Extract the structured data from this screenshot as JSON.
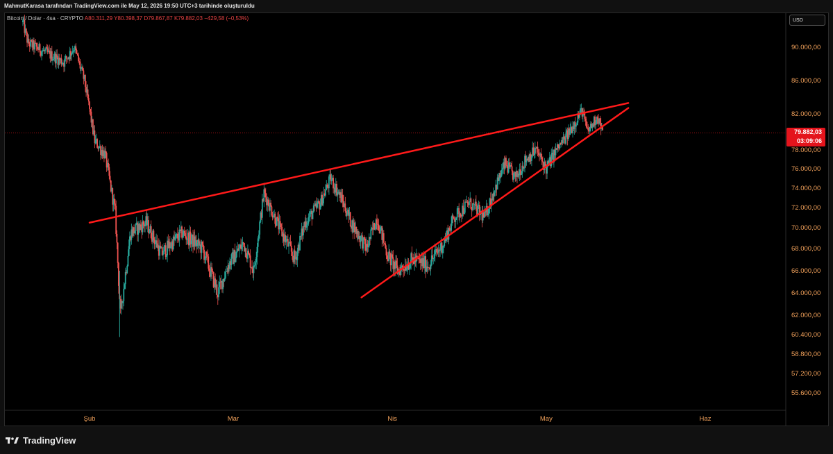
{
  "header": {
    "title": "MahmutKarasa tarafından TradingView.com ile May 12, 2026 19:50 UTC+3 tarihinde oluşturuldu"
  },
  "legend": {
    "symbol": "Bitcoin / Dolar · 4sa · CRYPTO",
    "open_label": "A",
    "open": "80.311,29",
    "high_label": "Y",
    "high": "80.398,37",
    "low_label": "D",
    "low": "79.867,87",
    "close_label": "K",
    "close": "79.882,03",
    "change": "−429,58 (−0,53%)"
  },
  "currency": "USD",
  "price_tag": {
    "price": "79.882,03",
    "countdown": "03:09:06",
    "color": "#e4141c"
  },
  "branding": {
    "name": "TradingView"
  },
  "colors": {
    "up": "#26a69a",
    "down": "#ef5350",
    "trendline": "#ff1a1a",
    "axis_text": "#f0a05a"
  },
  "chart_data": {
    "type": "candlestick",
    "y_ticks": [
      90000,
      86000,
      82000,
      78000,
      76000,
      74000,
      72000,
      70000,
      68000,
      66000,
      64000,
      62000,
      60400,
      58800,
      57200,
      55600
    ],
    "y_tick_labels": [
      "90.000,00",
      "86.000,00",
      "82.000,00",
      "78.000,00",
      "76.000,00",
      "74.000,00",
      "72.000,00",
      "70.000,00",
      "68.000,00",
      "66.000,00",
      "64.000,00",
      "62.000,00",
      "60.400,00",
      "58.800,00",
      "57.200,00",
      "55.600,00"
    ],
    "x_ticks": [
      "2026-02-01",
      "2026-03-01",
      "2026-04-01",
      "2026-05-01",
      "2026-06-01"
    ],
    "x_tick_labels": [
      "Şub",
      "Mar",
      "Nis",
      "May",
      "Haz"
    ],
    "x_range": [
      "2026-01-18",
      "2026-06-06"
    ],
    "last_price": 79882.03,
    "key_points": [
      {
        "date": "2026-01-19",
        "price": 93000
      },
      {
        "date": "2026-01-20",
        "price": 90500
      },
      {
        "date": "2026-01-23",
        "price": 89500
      },
      {
        "date": "2026-01-27",
        "price": 88200
      },
      {
        "date": "2026-01-29",
        "price": 90000
      },
      {
        "date": "2026-01-31",
        "price": 86000
      },
      {
        "date": "2026-02-02",
        "price": 79000
      },
      {
        "date": "2026-02-04",
        "price": 77500
      },
      {
        "date": "2026-02-06",
        "price": 71500
      },
      {
        "date": "2026-02-07",
        "price": 62000
      },
      {
        "date": "2026-02-09",
        "price": 69500
      },
      {
        "date": "2026-02-12",
        "price": 70500
      },
      {
        "date": "2026-02-15",
        "price": 67500
      },
      {
        "date": "2026-02-19",
        "price": 69500
      },
      {
        "date": "2026-02-23",
        "price": 68000
      },
      {
        "date": "2026-02-26",
        "price": 64000
      },
      {
        "date": "2026-02-28",
        "price": 66500
      },
      {
        "date": "2026-03-03",
        "price": 68500
      },
      {
        "date": "2026-03-05",
        "price": 66000
      },
      {
        "date": "2026-03-07",
        "price": 73500
      },
      {
        "date": "2026-03-10",
        "price": 70000
      },
      {
        "date": "2026-03-13",
        "price": 67000
      },
      {
        "date": "2026-03-15",
        "price": 70500
      },
      {
        "date": "2026-03-18",
        "price": 72500
      },
      {
        "date": "2026-03-20",
        "price": 75000
      },
      {
        "date": "2026-03-22",
        "price": 73000
      },
      {
        "date": "2026-03-24",
        "price": 70500
      },
      {
        "date": "2026-03-27",
        "price": 68000
      },
      {
        "date": "2026-03-29",
        "price": 71000
      },
      {
        "date": "2026-03-31",
        "price": 67500
      },
      {
        "date": "2026-04-02",
        "price": 66000
      },
      {
        "date": "2026-04-05",
        "price": 67000
      },
      {
        "date": "2026-04-08",
        "price": 66500
      },
      {
        "date": "2026-04-11",
        "price": 68500
      },
      {
        "date": "2026-04-13",
        "price": 71000
      },
      {
        "date": "2026-04-16",
        "price": 72500
      },
      {
        "date": "2026-04-19",
        "price": 71000
      },
      {
        "date": "2026-04-21",
        "price": 74000
      },
      {
        "date": "2026-04-23",
        "price": 76500
      },
      {
        "date": "2026-04-25",
        "price": 75000
      },
      {
        "date": "2026-04-27",
        "price": 77000
      },
      {
        "date": "2026-04-29",
        "price": 78000
      },
      {
        "date": "2026-05-01",
        "price": 76000
      },
      {
        "date": "2026-05-03",
        "price": 78000
      },
      {
        "date": "2026-05-05",
        "price": 79500
      },
      {
        "date": "2026-05-07",
        "price": 81500
      },
      {
        "date": "2026-05-08",
        "price": 82400
      },
      {
        "date": "2026-05-09",
        "price": 80000
      },
      {
        "date": "2026-05-10",
        "price": 80800
      },
      {
        "date": "2026-05-11",
        "price": 81800
      },
      {
        "date": "2026-05-12",
        "price": 79882
      }
    ],
    "trendlines": [
      {
        "name": "upper",
        "from": {
          "date": "2026-02-01",
          "price": 70500
        },
        "to": {
          "date": "2026-05-17",
          "price": 83300
        }
      },
      {
        "name": "lower",
        "from": {
          "date": "2026-03-26",
          "price": 63600
        },
        "to": {
          "date": "2026-05-17",
          "price": 82700
        }
      }
    ]
  }
}
